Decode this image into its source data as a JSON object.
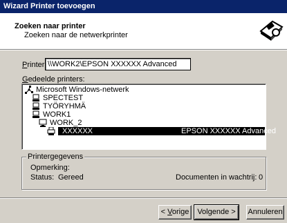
{
  "window": {
    "title": "Wizard Printer toevoegen"
  },
  "header": {
    "title": "Zoeken naar printer",
    "subtitle": "Zoeken naar de netwerkprinter",
    "icon": "printer-magnifier-icon"
  },
  "printer": {
    "label_key": "P",
    "label_rest": "rinter:",
    "value": "\\\\WORK2\\EPSON XXXXXX Advanced"
  },
  "shared": {
    "label_key": "G",
    "label_rest": "edeelde printers:",
    "tree": [
      {
        "label": "Microsoft Windows-netwerk",
        "icon": "network-icon",
        "level": 0
      },
      {
        "label": "SPECTEST",
        "icon": "workgroup-icon",
        "level": 1
      },
      {
        "label": "TYÖRYHMÄ",
        "icon": "workgroup-icon",
        "level": 1
      },
      {
        "label": "WORK1",
        "icon": "workgroup-icon",
        "level": 1
      },
      {
        "label": "WORK_2",
        "icon": "computer-icon",
        "level": 2
      },
      {
        "label": "XXXXXX",
        "icon": "printer-icon",
        "level": 3,
        "selected": true,
        "description": "EPSON XXXXXX Advanced"
      }
    ]
  },
  "details": {
    "title": "Printergegevens",
    "comment_label": "Opmerking:",
    "comment_value": "",
    "status_label": "Status:",
    "status_value": "Gereed",
    "docs_label": "Documenten in wachtrij:",
    "docs_value": "0"
  },
  "buttons": {
    "back_prefix": "< ",
    "back_key": "V",
    "back_rest": "orige",
    "next": "Volgende >",
    "cancel": "Annuleren"
  }
}
